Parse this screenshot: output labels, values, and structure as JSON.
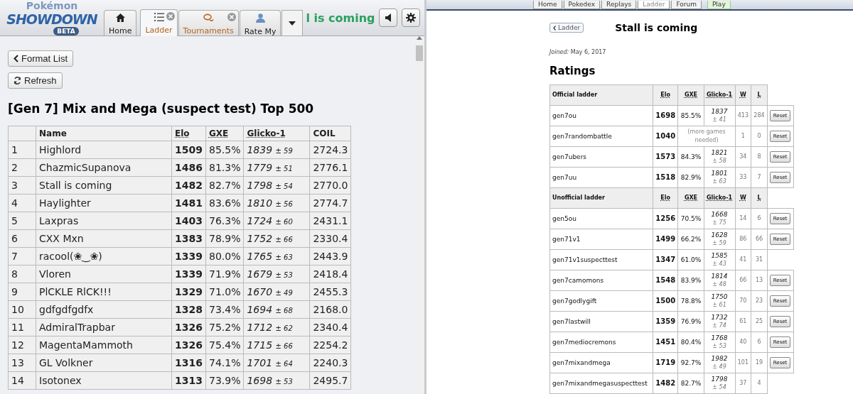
{
  "client": {
    "logo": {
      "top": "Pokémon",
      "main": "SHOWDOWN",
      "badge": "BETA"
    },
    "tabs": [
      {
        "label": "Home",
        "closable": false,
        "selected": false
      },
      {
        "label": "Ladder",
        "closable": true,
        "selected": true
      },
      {
        "label": "Tournaments",
        "closable": true,
        "selected": false
      },
      {
        "label": "Rate My",
        "closable": false,
        "selected": false
      }
    ],
    "username": "l is coming",
    "buttons": {
      "format_list": "Format List",
      "refresh": "Refresh"
    },
    "heading": "[Gen 7] Mix and Mega (suspect test) Top 500",
    "table": {
      "columns": [
        "",
        "Name",
        "Elo",
        "GXE",
        "Glicko-1",
        "COIL"
      ],
      "rows": [
        {
          "rank": "1",
          "name": "Highlord",
          "elo": "1509",
          "gxe": "85.5%",
          "glicko": "1839",
          "deviation": "± 59",
          "coil": "2724.3"
        },
        {
          "rank": "2",
          "name": "ChazmicSupanova",
          "elo": "1486",
          "gxe": "81.3%",
          "glicko": "1779",
          "deviation": "± 51",
          "coil": "2776.1"
        },
        {
          "rank": "3",
          "name": "Stall is coming",
          "elo": "1482",
          "gxe": "82.7%",
          "glicko": "1798",
          "deviation": "± 54",
          "coil": "2770.0"
        },
        {
          "rank": "4",
          "name": "Haylighter",
          "elo": "1481",
          "gxe": "83.6%",
          "glicko": "1810",
          "deviation": "± 56",
          "coil": "2774.7"
        },
        {
          "rank": "5",
          "name": "Laxpras",
          "elo": "1403",
          "gxe": "76.3%",
          "glicko": "1724",
          "deviation": "± 60",
          "coil": "2431.1"
        },
        {
          "rank": "6",
          "name": "CXX Mxn",
          "elo": "1383",
          "gxe": "78.9%",
          "glicko": "1752",
          "deviation": "± 66",
          "coil": "2330.4"
        },
        {
          "rank": "7",
          "name": "racool(❀‿❀)",
          "elo": "1339",
          "gxe": "80.0%",
          "glicko": "1765",
          "deviation": "± 63",
          "coil": "2443.9"
        },
        {
          "rank": "8",
          "name": "Vloren",
          "elo": "1339",
          "gxe": "71.9%",
          "glicko": "1679",
          "deviation": "± 53",
          "coil": "2418.4"
        },
        {
          "rank": "9",
          "name": "PlCKLE RlCK!!!",
          "elo": "1329",
          "gxe": "71.0%",
          "glicko": "1670",
          "deviation": "± 49",
          "coil": "2455.3"
        },
        {
          "rank": "10",
          "name": "gdfgdfgdfx",
          "elo": "1328",
          "gxe": "73.4%",
          "glicko": "1694",
          "deviation": "± 68",
          "coil": "2168.0"
        },
        {
          "rank": "11",
          "name": "AdmiralTrapbar",
          "elo": "1326",
          "gxe": "75.2%",
          "glicko": "1712",
          "deviation": "± 62",
          "coil": "2340.4"
        },
        {
          "rank": "12",
          "name": "MagentaMammoth",
          "elo": "1326",
          "gxe": "75.4%",
          "glicko": "1715",
          "deviation": "± 66",
          "coil": "2254.2"
        },
        {
          "rank": "13",
          "name": "GL Volkner",
          "elo": "1316",
          "gxe": "74.1%",
          "glicko": "1701",
          "deviation": "± 64",
          "coil": "2240.3"
        },
        {
          "rank": "14",
          "name": "Isotonex",
          "elo": "1313",
          "gxe": "73.9%",
          "glicko": "1698",
          "deviation": "± 53",
          "coil": "2495.7"
        }
      ]
    }
  },
  "website": {
    "nav": [
      {
        "label": "Home",
        "selected": false
      },
      {
        "label": "Pokedex",
        "selected": false
      },
      {
        "label": "Replays",
        "selected": false
      },
      {
        "label": "Ladder",
        "selected": true
      },
      {
        "label": "Forum",
        "selected": false
      },
      {
        "label": "Play",
        "selected": false
      }
    ],
    "back_button": "Ladder",
    "title": "Stall is coming",
    "joined": "*Joined:* May 6, 2017",
    "ratings_heading": "Ratings",
    "rows": [
      {
        "kind": "section",
        "label": "Official ladder",
        "cols": [
          "Elo",
          "GXE",
          "Glicko-1",
          "W",
          "L"
        ]
      },
      {
        "kind": "rating",
        "format": "gen7ou",
        "elo": "1698",
        "gxe": "85.5%",
        "glicko": "1837",
        "deviation": "± 41",
        "w": "413",
        "l": "284",
        "reset": "Reset"
      },
      {
        "kind": "provisional",
        "format": "gen7randombattle",
        "elo": "1040",
        "note": "(more games needed)",
        "w": "1",
        "l": "0",
        "reset": "Reset"
      },
      {
        "kind": "rating",
        "format": "gen7ubers",
        "elo": "1573",
        "gxe": "84.3%",
        "glicko": "1821",
        "deviation": "± 58",
        "w": "34",
        "l": "8",
        "reset": "Reset"
      },
      {
        "kind": "rating",
        "format": "gen7uu",
        "elo": "1518",
        "gxe": "82.9%",
        "glicko": "1801",
        "deviation": "± 63",
        "w": "33",
        "l": "7",
        "reset": "Reset"
      },
      {
        "kind": "section",
        "label": "Unofficial ladder",
        "cols": [
          "Elo",
          "GXE",
          "Glicko-1",
          "W",
          "L"
        ]
      },
      {
        "kind": "rating",
        "format": "gen5ou",
        "elo": "1256",
        "gxe": "70.5%",
        "glicko": "1668",
        "deviation": "± 75",
        "w": "14",
        "l": "6",
        "reset": "Reset"
      },
      {
        "kind": "rating",
        "format": "gen71v1",
        "elo": "1499",
        "gxe": "66.2%",
        "glicko": "1628",
        "deviation": "± 59",
        "w": "86",
        "l": "66",
        "reset": "Reset"
      },
      {
        "kind": "rating",
        "format": "gen71v1suspecttest",
        "elo": "1347",
        "gxe": "61.0%",
        "glicko": "1585",
        "deviation": "± 43",
        "w": "41",
        "l": "31"
      },
      {
        "kind": "rating",
        "format": "gen7camomons",
        "elo": "1548",
        "gxe": "83.9%",
        "glicko": "1814",
        "deviation": "± 48",
        "w": "66",
        "l": "13",
        "reset": "Reset"
      },
      {
        "kind": "rating",
        "format": "gen7godlygift",
        "elo": "1500",
        "gxe": "78.8%",
        "glicko": "1750",
        "deviation": "± 61",
        "w": "70",
        "l": "23",
        "reset": "Reset"
      },
      {
        "kind": "rating",
        "format": "gen7lastwill",
        "elo": "1359",
        "gxe": "76.9%",
        "glicko": "1732",
        "deviation": "± 74",
        "w": "61",
        "l": "25",
        "reset": "Reset"
      },
      {
        "kind": "rating",
        "format": "gen7mediocremons",
        "elo": "1451",
        "gxe": "80.4%",
        "glicko": "1768",
        "deviation": "± 53",
        "w": "40",
        "l": "6",
        "reset": "Reset"
      },
      {
        "kind": "rating",
        "format": "gen7mixandmega",
        "elo": "1719",
        "gxe": "92.7%",
        "glicko": "1982",
        "deviation": "± 49",
        "w": "101",
        "l": "19",
        "reset": "Reset"
      },
      {
        "kind": "rating",
        "format": "gen7mixandmegasuspecttest",
        "elo": "1482",
        "gxe": "82.7%",
        "glicko": "1798",
        "deviation": "± 54",
        "w": "37",
        "l": "4"
      }
    ]
  }
}
